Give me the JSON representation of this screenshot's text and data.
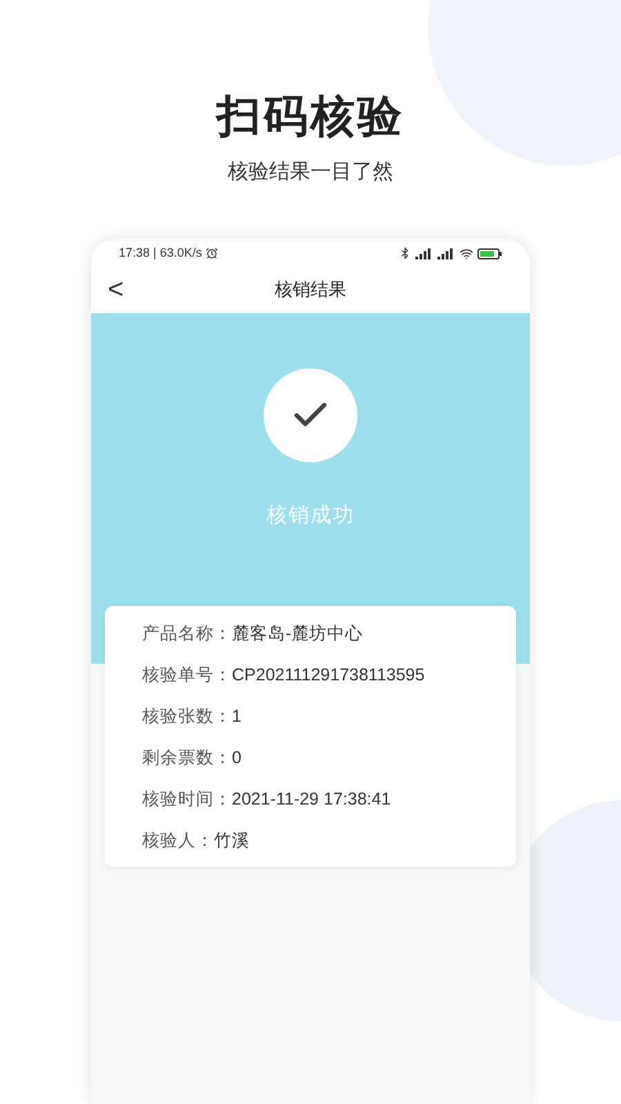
{
  "headline": "扫码核验",
  "subtitle": "核验结果一目了然",
  "status_bar": {
    "text": "17:38 | 63.0K/s"
  },
  "nav": {
    "back": "<",
    "title": "核销结果"
  },
  "result": {
    "message": "核销成功"
  },
  "details": [
    {
      "label": "产品名称：",
      "value": "麓客岛-麓坊中心"
    },
    {
      "label": "核验单号：",
      "value": "CP202111291738113595"
    },
    {
      "label": "核验张数：",
      "value": "1"
    },
    {
      "label": "剩余票数：",
      "value": "0"
    },
    {
      "label": "核验时间：",
      "value": "2021-11-29 17:38:41"
    },
    {
      "label": "核验人：",
      "value": "竹溪"
    }
  ]
}
